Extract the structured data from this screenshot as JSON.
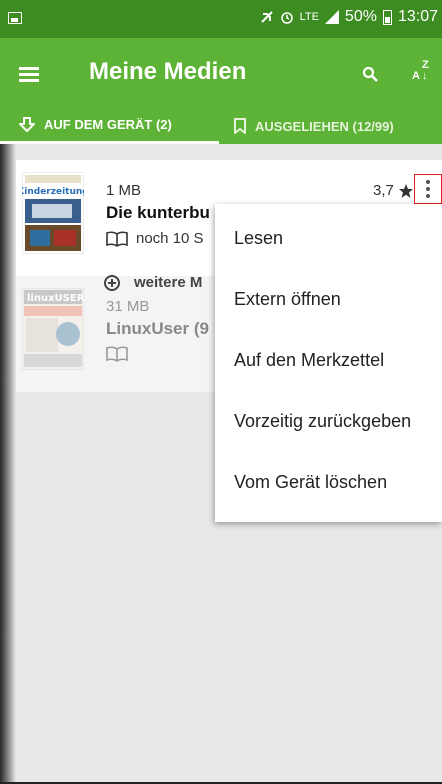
{
  "status_bar": {
    "network": "LTE",
    "battery": "50%",
    "time": "13:07"
  },
  "app_bar": {
    "title": "Meine Medien",
    "sort_label_top": "Z",
    "sort_label_bottom": "A",
    "accent_color": "#5cb336"
  },
  "tabs": [
    {
      "label": "AUF DEM GERÄT (2)",
      "active": true
    },
    {
      "label": "AUSGELIEHEN (12/99)",
      "active": false
    }
  ],
  "items": [
    {
      "size": "1 MB",
      "title": "Die kunterbu",
      "meta": "noch 10 S",
      "rating": "3,7",
      "cover_text": "Kinderzeitung"
    },
    {
      "size": "31 MB",
      "title": "LinuxUser (9",
      "meta": "",
      "cover_text": "linuxUSER"
    }
  ],
  "more": {
    "label": "weitere M"
  },
  "popup_menu": [
    "Lesen",
    "Extern öffnen",
    "Auf den Merkzettel",
    "Vorzeitig zurückgeben",
    "Vom Gerät löschen"
  ]
}
